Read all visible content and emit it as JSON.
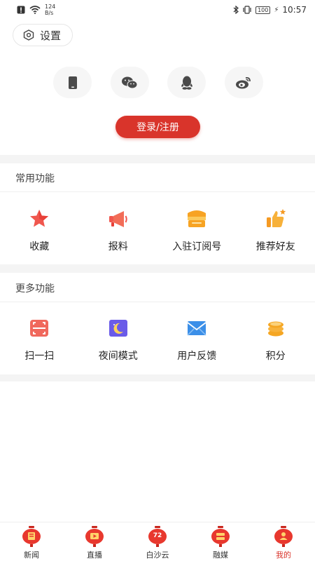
{
  "status_bar": {
    "speed_value": "124",
    "speed_unit": "B/s",
    "battery": "100",
    "time": "10:57"
  },
  "settings": {
    "label": "设置"
  },
  "login_options": [
    {
      "icon": "phone-icon"
    },
    {
      "icon": "wechat-icon"
    },
    {
      "icon": "qq-icon"
    },
    {
      "icon": "weibo-icon"
    }
  ],
  "login_button": {
    "label": "登录/注册"
  },
  "common_section": {
    "title": "常用功能",
    "items": [
      {
        "label": "收藏",
        "icon": "star-icon"
      },
      {
        "label": "报料",
        "icon": "megaphone-icon"
      },
      {
        "label": "入驻订阅号",
        "icon": "store-icon"
      },
      {
        "label": "推荐好友",
        "icon": "thumbs-up-icon"
      }
    ]
  },
  "more_section": {
    "title": "更多功能",
    "items": [
      {
        "label": "扫一扫",
        "icon": "scan-icon"
      },
      {
        "label": "夜间模式",
        "icon": "moon-icon"
      },
      {
        "label": "用户反馈",
        "icon": "mail-icon"
      },
      {
        "label": "积分",
        "icon": "coins-icon"
      }
    ]
  },
  "bottom_nav": {
    "items": [
      {
        "label": "新闻",
        "active": false
      },
      {
        "label": "直播",
        "active": false
      },
      {
        "label": "白沙云",
        "badge": "72",
        "active": false
      },
      {
        "label": "融媒",
        "active": false
      },
      {
        "label": "我的",
        "active": true
      }
    ]
  },
  "colors": {
    "accent": "#d9342b",
    "background": "#ffffff",
    "divider": "#f4f4f4"
  }
}
